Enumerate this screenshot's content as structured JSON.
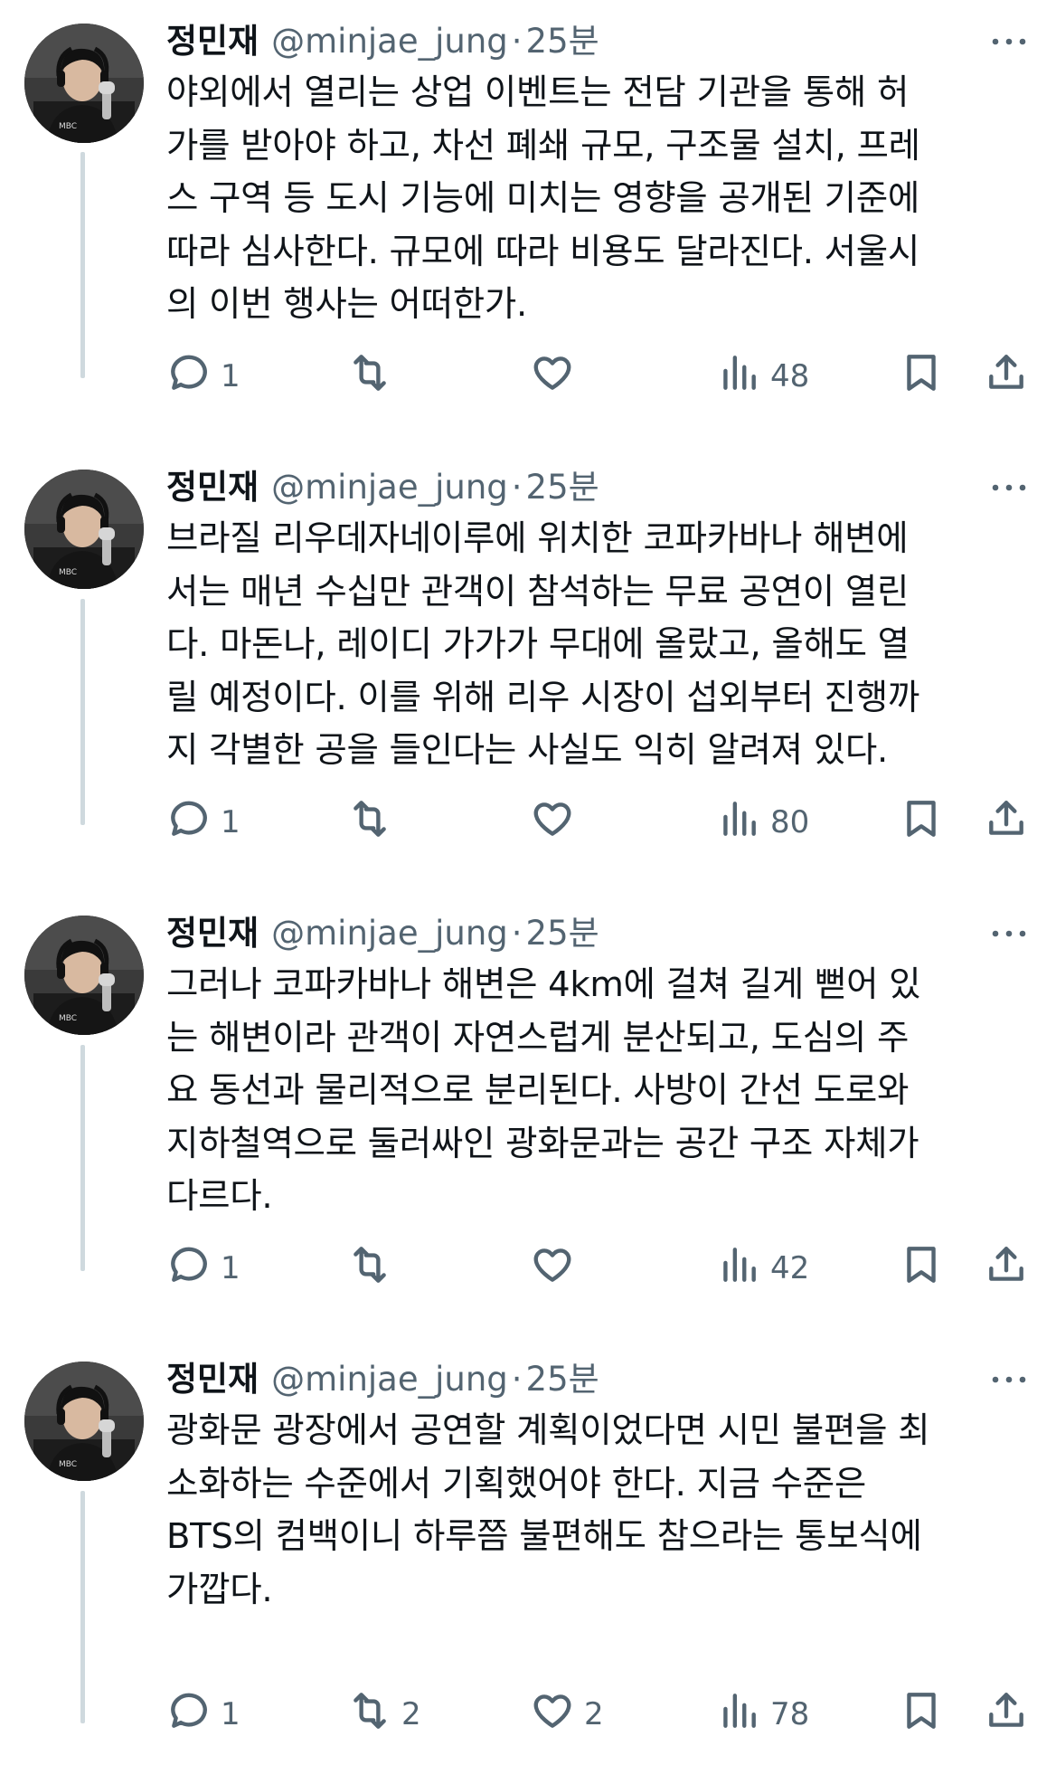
{
  "tweets": [
    {
      "name": "정민재",
      "handle": "@minjae_jung",
      "dot": "·",
      "time": "25분",
      "text": "야외에서 열리는 상업 이벤트는 전담 기관을 통해 허\n가를 받아야 하고, 차선 폐쇄 규모, 구조물 설치, 프레\n스 구역 등 도시 기능에 미치는 영향을 공개된 기준에\n따라 심사한다. 규모에 따라 비용도 달라진다. 서울시\n의 이번 행사는 어떠한가.",
      "replies": "1",
      "retweets": "",
      "likes": "",
      "views": "48"
    },
    {
      "name": "정민재",
      "handle": "@minjae_jung",
      "dot": "·",
      "time": "25분",
      "text": "브라질 리우데자네이루에 위치한 코파카바나 해변에\n서는 매년 수십만 관객이 참석하는 무료 공연이 열린\n다. 마돈나, 레이디 가가가 무대에 올랐고, 올해도 열\n릴 예정이다. 이를 위해 리우 시장이 섭외부터 진행까\n지 각별한 공을 들인다는 사실도 익히 알려져 있다.",
      "replies": "1",
      "retweets": "",
      "likes": "",
      "views": "80"
    },
    {
      "name": "정민재",
      "handle": "@minjae_jung",
      "dot": "·",
      "time": "25분",
      "text": "그러나 코파카바나 해변은 4km에 걸쳐 길게 뻗어 있\n는 해변이라 관객이 자연스럽게 분산되고, 도심의 주\n요 동선과 물리적으로 분리된다. 사방이 간선 도로와\n지하철역으로 둘러싸인 광화문과는 공간 구조 자체가\n다르다.",
      "replies": "1",
      "retweets": "",
      "likes": "",
      "views": "42"
    },
    {
      "name": "정민재",
      "handle": "@minjae_jung",
      "dot": "·",
      "time": "25분",
      "text": "광화문 광장에서 공연할 계획이었다면 시민 불편을 최\n소화하는 수준에서 기획했어야 한다. 지금 수준은\nBTS의 컴백이니 하루쯤 불편해도 참으라는 통보식에\n가깝다.",
      "replies": "1",
      "retweets": "2",
      "likes": "2",
      "views": "78"
    }
  ],
  "icons": {
    "reply": "reply-icon",
    "retweet": "retweet-icon",
    "like": "heart-icon",
    "views": "views-icon",
    "bookmark": "bookmark-icon",
    "share": "share-icon",
    "more": "more-icon"
  },
  "colors": {
    "text": "#0f1419",
    "secondary": "#536471",
    "thread_line": "#cfd9de"
  }
}
